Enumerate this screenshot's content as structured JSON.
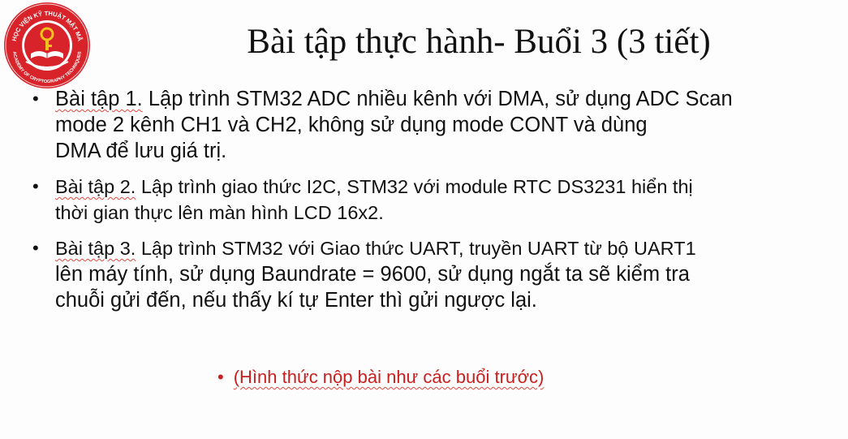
{
  "logo": {
    "icon": "academy-seal-icon",
    "ring_text_top": "HỌC VIỆN KỸ THUẬT MẬT MÃ",
    "ring_text_bottom": "ACADEMY OF CRYPTOGRAPHY TECHNIQUES",
    "colors": {
      "ring": "#d8232a",
      "inner": "#ffffff",
      "accent": "#f3c21b"
    }
  },
  "title": "Bài tập thực hành- Buổi 3 (3 tiết)",
  "bullets": [
    {
      "label": "Bài tập 1.",
      "line1_rest": " Lập trình STM32 ADC nhiều kênh với DMA, sử dụng ADC Scan",
      "line2": "mode 2 kênh CH1 và CH2, không sử dụng mode CONT và dùng",
      "line3": "DMA để lưu giá trị."
    },
    {
      "label": "Bài tập 2.",
      "line1_rest": " Lập trình giao thức I2C, STM32 với module RTC DS3231 hiển thị",
      "line2": "thời gian thực lên màn hình LCD 16x2."
    },
    {
      "label": "Bài tập 3.",
      "line1_rest": " Lập trình STM32 với Giao thức UART, truyền UART từ bộ UART1",
      "line2": "lên máy tính, sử dụng Baundrate = 9600, sử dụng ngắt ta sẽ kiểm tra",
      "line3": "chuỗi gửi đến, nếu thấy kí tự Enter thì gửi ngược lại."
    }
  ],
  "note": "(Hình thức nộp bài như các buổi trước)",
  "colors": {
    "note": "#c8201e",
    "text": "#111111",
    "spellcheck": "#e0493e"
  }
}
